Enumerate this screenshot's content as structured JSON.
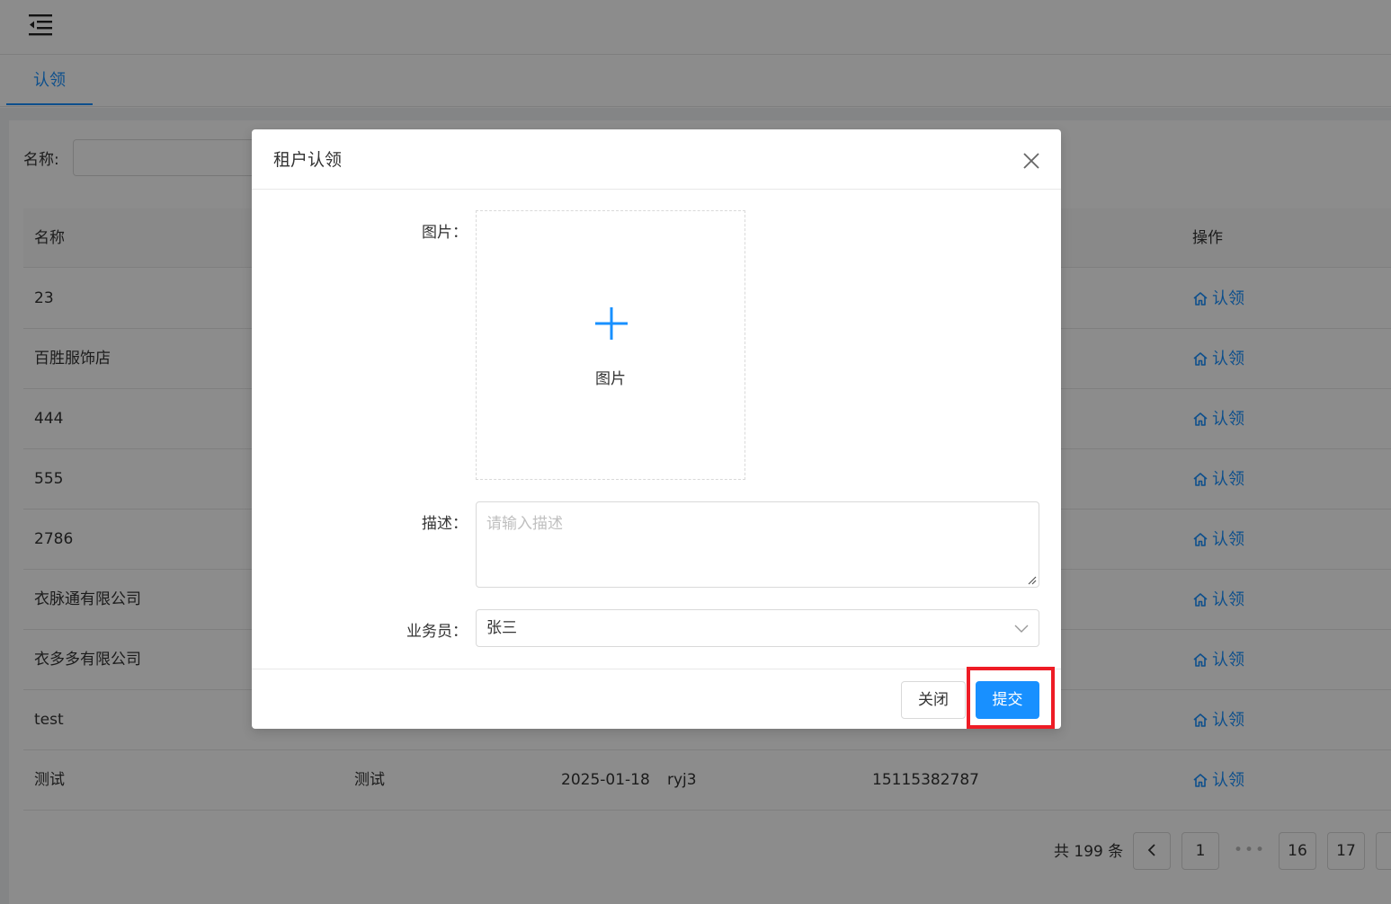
{
  "tabs": [
    {
      "label": "认领"
    }
  ],
  "search": {
    "label": "名称:"
  },
  "table": {
    "columns": {
      "name": "名称",
      "action": "操作"
    },
    "rows": [
      {
        "name": "23",
        "c2": "",
        "c3": "",
        "c4": "",
        "c5": "",
        "action": "认领"
      },
      {
        "name": "百胜服饰店",
        "c2": "",
        "c3": "",
        "c4": "",
        "c5": "",
        "action": "认领"
      },
      {
        "name": "444",
        "c2": "",
        "c3": "",
        "c4": "",
        "c5": "",
        "action": "认领"
      },
      {
        "name": "555",
        "c2": "",
        "c3": "",
        "c4": "",
        "c5": "",
        "action": "认领"
      },
      {
        "name": "2786",
        "c2": "",
        "c3": "",
        "c4": "",
        "c5": "",
        "action": "认领"
      },
      {
        "name": "衣脉通有限公司",
        "c2": "",
        "c3": "",
        "c4": "",
        "c5": "",
        "action": "认领"
      },
      {
        "name": "衣多多有限公司",
        "c2": "",
        "c3": "",
        "c4": "",
        "c5": "",
        "action": "认领"
      },
      {
        "name": "test",
        "c2": "",
        "c3": "",
        "c4": "",
        "c5": "",
        "action": "认领"
      },
      {
        "name": "测试",
        "c2": "测试",
        "c3": "2025-01-18",
        "c4": "ryj3",
        "c5": "15115382787",
        "action": "认领"
      }
    ]
  },
  "pagination": {
    "total": "共 199 条",
    "pages": [
      "1",
      "16",
      "17"
    ],
    "ellipsis": "•••"
  },
  "modal": {
    "title": "租户认领",
    "image_label": "图片：",
    "upload_text": "图片",
    "desc_label": "描述：",
    "desc_placeholder": "请输入描述",
    "salesperson_label": "业务员：",
    "salesperson_value": "张三",
    "close_label": "关闭",
    "submit_label": "提交"
  },
  "colors": {
    "accent": "#1890ff",
    "highlight": "#ee1c25",
    "mask": "rgba(0,0,0,0.45)"
  }
}
